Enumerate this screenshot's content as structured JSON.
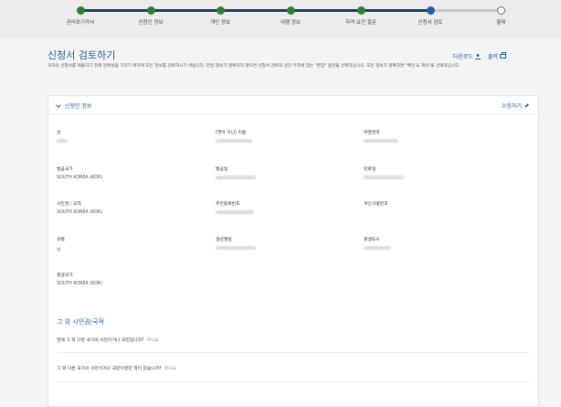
{
  "progress": {
    "steps": [
      {
        "label": "권리포기각서",
        "status": "done"
      },
      {
        "label": "신청인 정보",
        "status": "done"
      },
      {
        "label": "개인 정보",
        "status": "done"
      },
      {
        "label": "여행 정보",
        "status": "done"
      },
      {
        "label": "자격 요건 질문",
        "status": "done"
      },
      {
        "label": "신청서 검토",
        "status": "current"
      },
      {
        "label": "결제",
        "status": "todo"
      }
    ]
  },
  "page": {
    "title": "신청서 검토하기",
    "description": "귀하의 신청서를 제출하기 전에 정확성을 기하기 위하여 모든 정보를 검토하시기 바랍니다. 만일 정보가 정확하지 않으면 신청서 검토의 상단 우측에 있는 \"편집\" 옵션을 선택하십시오. 모든 정보가 정확하면 \"확인 & 계속\"을 선택하십시오.",
    "download_label": "다운로드",
    "print_label": "출력"
  },
  "section": {
    "title": "신청인 정보",
    "edit_label": "수정하기",
    "fields": {
      "surname": {
        "label": "성"
      },
      "given_name": {
        "label": "(영어 이닌) 이름"
      },
      "passport_number": {
        "label": "여권번호"
      },
      "issuing_country": {
        "label": "발급국가",
        "value": "SOUTH KOREA (KOR)"
      },
      "issue_date": {
        "label": "발급일"
      },
      "expiry_date": {
        "label": "만료일"
      },
      "citizenship": {
        "label": "시민권 / 국적",
        "value": "SOUTH KOREA (KOR)"
      },
      "national_id": {
        "label": "주민등록번호"
      },
      "personal_id": {
        "label": "개인식별번호"
      },
      "gender": {
        "label": "성별",
        "value": "남"
      },
      "birth_date": {
        "label": "생년월일"
      },
      "birth_city": {
        "label": "출생도시"
      },
      "birth_country": {
        "label": "출생국가",
        "value": "SOUTH KOREA (KOR)"
      }
    },
    "other_citizenship": {
      "title": "그 외 시민권/국적",
      "q1": "현재 그 외 다른 국가의 시민이거나 국민입니까?",
      "a1": "아니요",
      "q2": "그 외 다른 국가의 시민이거나 국민이었던 적이 있습니까?",
      "a2": "아니요"
    }
  }
}
